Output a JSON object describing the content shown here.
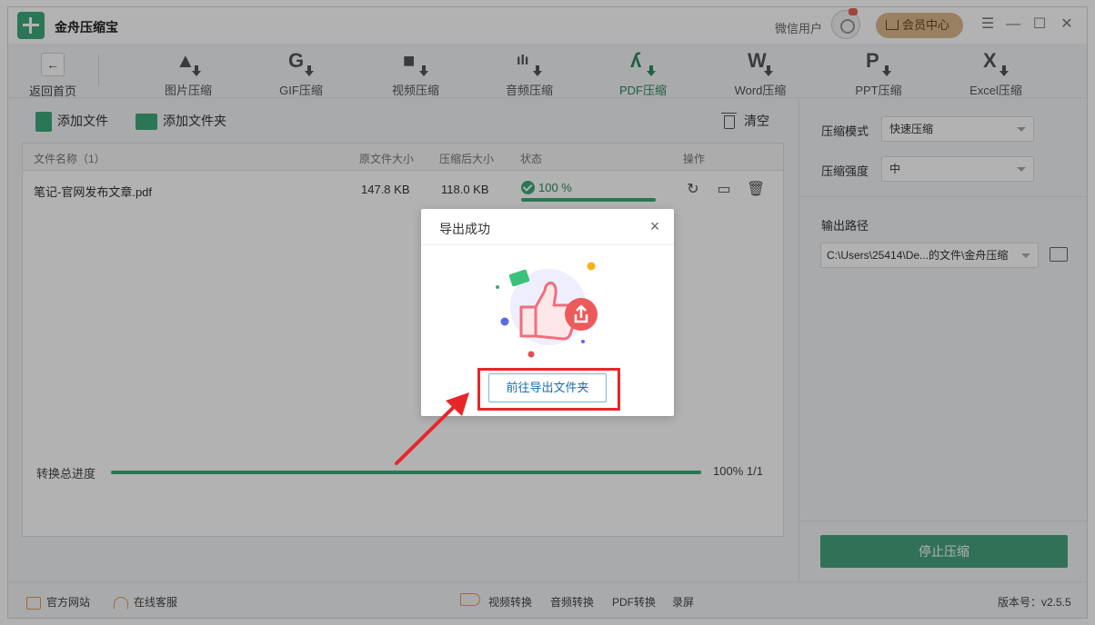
{
  "app": {
    "title": "金舟压缩宝",
    "user_name": "微信用户",
    "vip_label": "会员中心"
  },
  "window_controls": {
    "menu": "☰",
    "minimize": "—",
    "maximize": "☐",
    "close": "✕"
  },
  "toolbar": {
    "back": {
      "label": "返回首页",
      "icon": "←"
    },
    "tools": [
      {
        "label": "图片压缩",
        "glyph": "▲",
        "icon": "image-compress-icon"
      },
      {
        "label": "GIF压缩",
        "glyph": "G",
        "icon": "gif-compress-icon"
      },
      {
        "label": "视频压缩",
        "glyph": "■",
        "icon": "video-compress-icon"
      },
      {
        "label": "音频压缩",
        "glyph": "ıIı",
        "icon": "audio-compress-icon"
      },
      {
        "label": "PDF压缩",
        "glyph": "ʎ",
        "icon": "pdf-compress-icon",
        "active": true
      },
      {
        "label": "Word压缩",
        "glyph": "W",
        "icon": "word-compress-icon"
      },
      {
        "label": "PPT压缩",
        "glyph": "P",
        "icon": "ppt-compress-icon"
      },
      {
        "label": "Excel压缩",
        "glyph": "X",
        "icon": "excel-compress-icon"
      }
    ]
  },
  "actions": {
    "add_file": "添加文件",
    "add_folder": "添加文件夹",
    "clear": "清空"
  },
  "table": {
    "headers": {
      "name": "文件名称（1）",
      "original": "原文件大小",
      "compressed": "压缩后大小",
      "status": "状态",
      "ops": "操作"
    },
    "rows": [
      {
        "name": "笔记-官网发布文章.pdf",
        "original": "147.8 KB",
        "compressed": "118.0 KB",
        "status": "100 %",
        "progress": 1.0
      }
    ]
  },
  "total": {
    "label": "转换总进度",
    "value": "100% 1/1",
    "progress": 1.0
  },
  "settings": {
    "mode_label": "压缩模式",
    "mode_value": "快速压缩",
    "strength_label": "压缩强度",
    "strength_value": "中",
    "output_label": "输出路径",
    "output_value": "C:\\Users\\25414\\De...的文件\\金舟压缩",
    "stop_button": "停止压缩"
  },
  "footer": {
    "website": "官方网站",
    "support": "在线客服",
    "links": [
      "视频转换",
      "音频转换",
      "PDF转换",
      "录屏"
    ],
    "version": "版本号：v2.5.5"
  },
  "dialog": {
    "title": "导出成功",
    "button": "前往导出文件夹"
  },
  "colors": {
    "accent": "#3daa7a",
    "vip": "#dcb88e",
    "highlight": "#e8262a",
    "dialog_button": "#1a6ea8"
  }
}
